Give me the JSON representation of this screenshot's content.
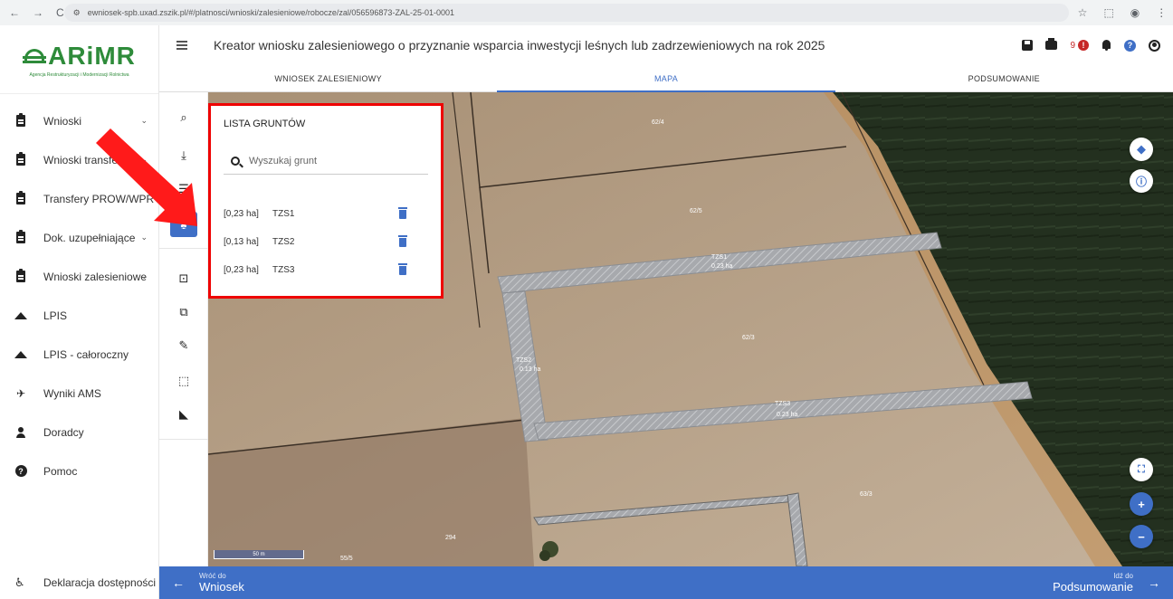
{
  "browser": {
    "url": "ewniosek-spb.uxad.zszik.pl/#/platnosci/wnioski/zalesieniowe/robocze/zal/056596873-ZAL-25-01-0001",
    "nav_back": "←",
    "nav_forward": "→",
    "reload": "C"
  },
  "logo": {
    "name": "ARiMR",
    "subtitle": "Agencja Restrukturyzacji i Modernizacji Rolnictwa"
  },
  "sidebar": {
    "items": [
      {
        "label": "Wnioski",
        "icon": "clipboard-icon",
        "chevron": "⌄"
      },
      {
        "label": "Wnioski transferowe",
        "icon": "clipboard-icon",
        "chevron": "⌄"
      },
      {
        "label": "Transfery PROW/WPR",
        "icon": "clipboard-icon",
        "chevron": ""
      },
      {
        "label": "Dok. uzupełniające",
        "icon": "clipboard-icon",
        "chevron": "⌄"
      },
      {
        "label": "Wnioski zalesieniowe",
        "icon": "clipboard-icon",
        "chevron": "⌄"
      },
      {
        "label": "LPIS",
        "icon": "mountain-icon",
        "chevron": ""
      },
      {
        "label": "LPIS - całoroczny",
        "icon": "mountain-icon",
        "chevron": ""
      },
      {
        "label": "Wyniki AMS",
        "icon": "satellite-icon",
        "chevron": ""
      },
      {
        "label": "Doradcy",
        "icon": "person-icon",
        "chevron": ""
      },
      {
        "label": "Pomoc",
        "icon": "help-icon",
        "chevron": ""
      }
    ],
    "accessibility": "Deklaracja dostępności"
  },
  "header": {
    "title": "Kreator wniosku zalesieniowego o przyznanie wsparcia inwestycji leśnych lub zadrzewieniowych na rok 2025",
    "error_count": "9",
    "help_glyph": "?",
    "error_glyph": "!"
  },
  "tabs": [
    {
      "label": "WNIOSEK ZALESIENIOWY",
      "active": false
    },
    {
      "label": "MAPA",
      "active": true
    },
    {
      "label": "PODSUMOWANIE",
      "active": false
    }
  ],
  "panel": {
    "title": "LISTA GRUNTÓW",
    "search_placeholder": "Wyszukaj grunt",
    "rows": [
      {
        "area": "[0,23 ha]",
        "name": "TZS1"
      },
      {
        "area": "[0,13 ha]",
        "name": "TZS2"
      },
      {
        "area": "[0,23 ha]",
        "name": "TZS3"
      }
    ]
  },
  "map": {
    "labels": {
      "p624": "62/4",
      "p625": "62/5",
      "p623": "62/3",
      "p633": "63/3",
      "p294": "294",
      "p555": "55/5",
      "tzs1_name": "TZS1",
      "tzs1_area": "0.23 ha",
      "tzs2_name": "TZS2",
      "tzs2_area": "0.13 ha",
      "tzs3_name": "TZS3",
      "tzs3_area": "0.23 ha"
    },
    "scale": "50 m",
    "zoom_in": "+",
    "zoom_out": "−"
  },
  "footer": {
    "back_small": "Wróć do",
    "back_big": "Wniosek",
    "next_small": "Idź do",
    "next_big": "Podsumowanie"
  },
  "colors": {
    "primary": "#3f6fc6",
    "brand_green": "#2e8b3a",
    "highlight_red": "#e00000",
    "error_red": "#c62828"
  }
}
